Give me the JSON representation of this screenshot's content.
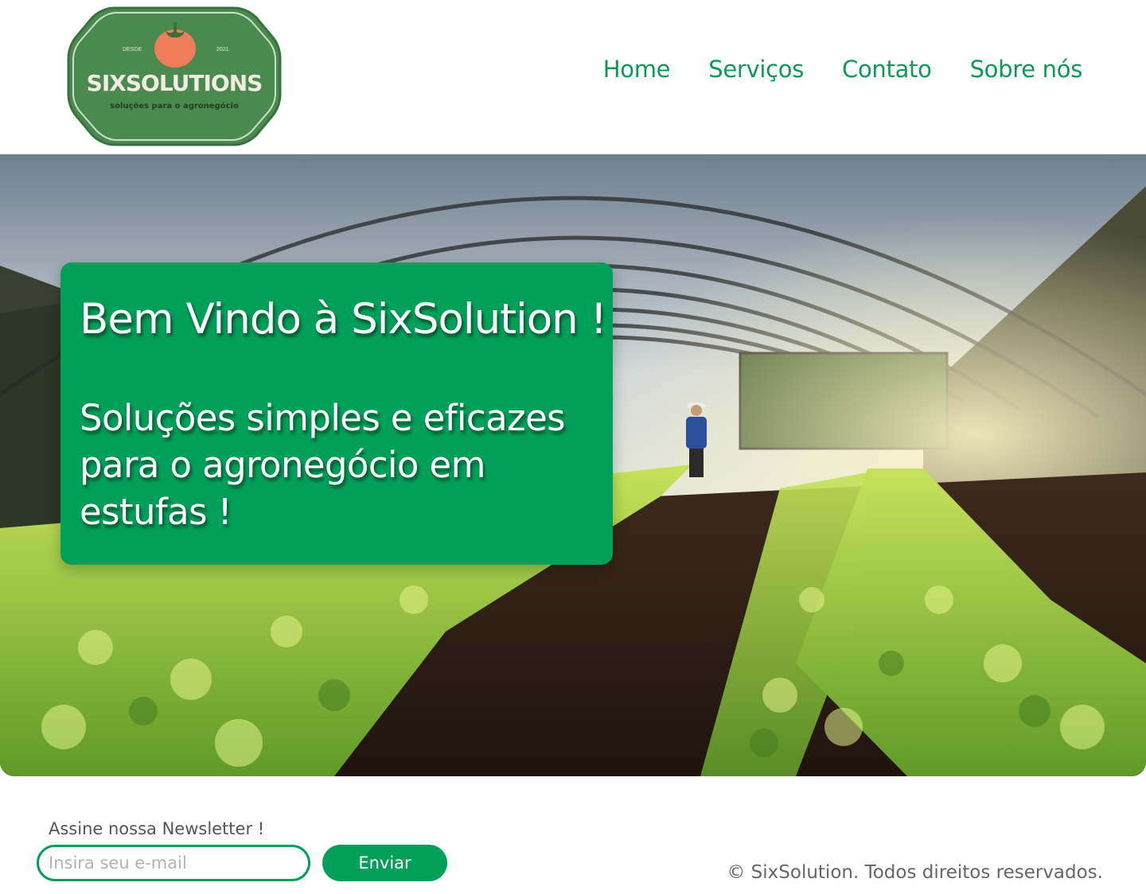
{
  "brand": {
    "name": "SIXSOLUTIONS",
    "since_label": "DESDE",
    "since_year": "2021",
    "tagline": "soluções para o agronegócio",
    "badge_color": "#4a8a4e",
    "accent_color": "#01a05a"
  },
  "nav": {
    "items": [
      {
        "label": "Home"
      },
      {
        "label": "Serviços"
      },
      {
        "label": "Contato"
      },
      {
        "label": "Sobre nós"
      }
    ]
  },
  "hero": {
    "image": "greenhouse-lettuce-photo",
    "title": "Bem Vindo à SixSolution !",
    "subtitle": "Soluções simples e eficazes para o agronegócio em estufas !"
  },
  "newsletter": {
    "label": "Assine nossa Newsletter !",
    "email_placeholder": "Insira seu e-mail",
    "email_value": "",
    "submit_label": "Enviar"
  },
  "footer": {
    "copyright": "© SixSolution. Todos direitos reservados."
  }
}
